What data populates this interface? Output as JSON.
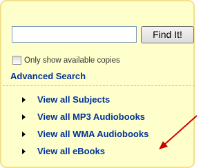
{
  "search": {
    "value": "",
    "button_label": "Find It!",
    "available_only_label": "Only show available copies",
    "available_only_checked": false,
    "advanced_search_label": "Advanced Search"
  },
  "nav": {
    "items": [
      {
        "label": "View all Subjects"
      },
      {
        "label": "View all MP3 Audiobooks"
      },
      {
        "label": "View all WMA Audiobooks"
      },
      {
        "label": "View all eBooks"
      }
    ]
  },
  "colors": {
    "panel_background": "#ffffcc",
    "panel_border": "#f2e08a",
    "link": "#003399",
    "arrow": "#cc0000"
  },
  "icons": {
    "nav_bullet": "triangle-right-icon",
    "annotation": "red-arrow-icon"
  }
}
